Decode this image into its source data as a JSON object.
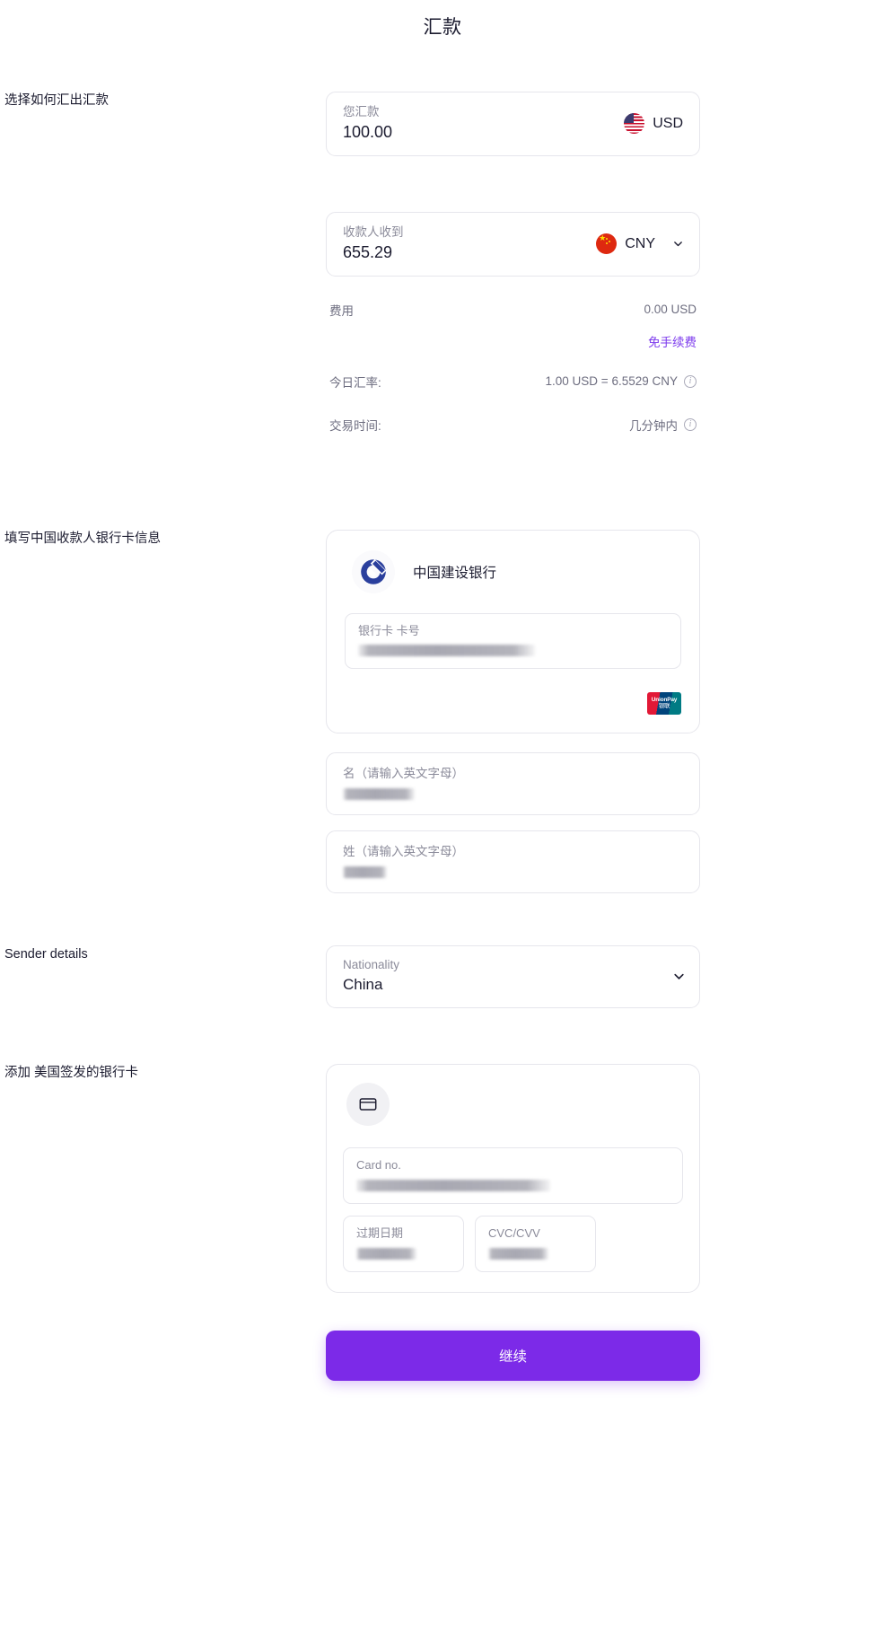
{
  "header": {
    "title": "汇款"
  },
  "sections": {
    "send": {
      "label": "选择如何汇出汇款",
      "you_send": {
        "label": "您汇款",
        "value": "100.00",
        "currency": "USD",
        "flag": "us-flag-icon"
      },
      "recipient_gets": {
        "label": "收款人收到",
        "value": "655.29",
        "currency": "CNY",
        "flag": "cn-flag-icon",
        "chevron": "chevron-down-icon"
      },
      "fees": {
        "fee_label": "费用",
        "fee_value": "0.00 USD",
        "fee_free_note": "免手续费",
        "rate_label": "今日汇率:",
        "rate_value": "1.00 USD = 6.5529 CNY",
        "time_label": "交易时间:",
        "time_value": "几分钟内",
        "info_glyph": "i"
      }
    },
    "recipient_bank": {
      "label": "填写中国收款人银行卡信息",
      "bank_name": "中国建设银行",
      "bank_logo": "ccb-logo-icon",
      "card_field_label": "银行卡 卡号",
      "card_field_value": "",
      "network_badge": "unionpay-logo-icon",
      "unionpay_text_en": "UnionPay",
      "unionpay_text_cn": "银联",
      "first_name_label": "名（请输入英文字母）",
      "first_name_value": "",
      "last_name_label": "姓（请输入英文字母）",
      "last_name_value": ""
    },
    "sender": {
      "label": "Sender details",
      "nationality_label": "Nationality",
      "nationality_value": "China",
      "chevron": "chevron-down-icon"
    },
    "add_card": {
      "label": "添加 美国签发的银行卡",
      "card_icon": "credit-card-icon",
      "card_no_label": "Card no.",
      "card_no_value": "",
      "expiry_label": "过期日期",
      "expiry_value": "",
      "cvc_label": "CVC/CVV",
      "cvc_value": ""
    }
  },
  "footer": {
    "continue_label": "继续"
  },
  "colors": {
    "accent": "#7c2ae8",
    "free_note": "#7c3aed",
    "text_primary": "#1b1b2f",
    "text_muted": "#8b8b9a",
    "border": "#e6e6ec",
    "flag_us_red": "#c8102e",
    "flag_us_blue": "#3c3b6e",
    "flag_cn_red": "#de2910",
    "flag_cn_yellow": "#ffde00",
    "bank_blue": "#2a3f9d"
  }
}
